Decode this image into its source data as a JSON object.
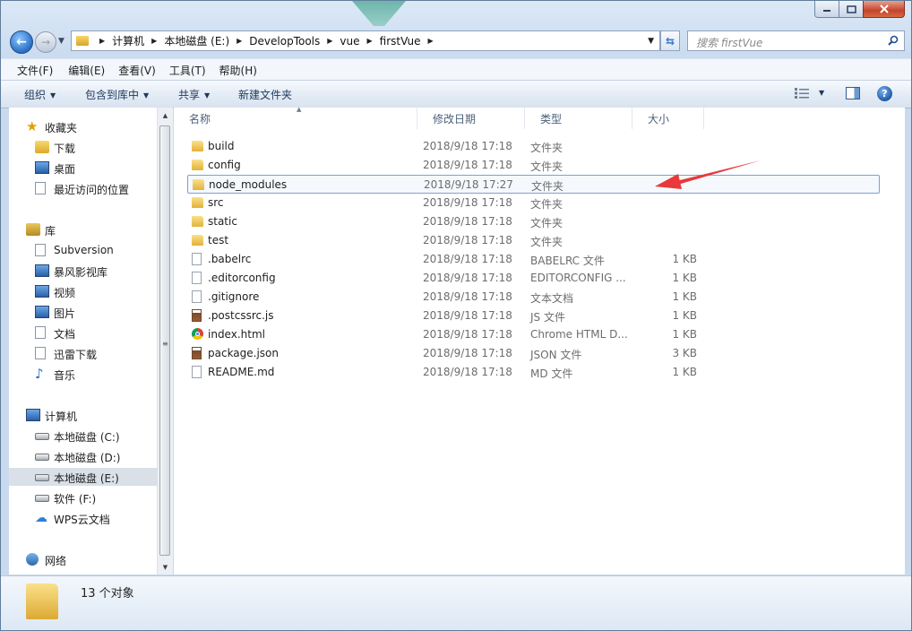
{
  "window": {
    "controls": {
      "minimize_icon": "minimize-icon",
      "maximize_icon": "maximize-icon",
      "close_icon": "close-icon"
    }
  },
  "address": {
    "crumbs": [
      "计算机",
      "本地磁盘 (E:)",
      "DevelopTools",
      "vue",
      "firstVue"
    ]
  },
  "search": {
    "placeholder": "搜索 firstVue"
  },
  "menu": [
    "文件(F)",
    "编辑(E)",
    "查看(V)",
    "工具(T)",
    "帮助(H)"
  ],
  "toolbar": {
    "organize": "组织",
    "include_library": "包含到库中",
    "share": "共享",
    "new_folder": "新建文件夹"
  },
  "nav": {
    "favorites": {
      "label": "收藏夹",
      "items": [
        "下载",
        "桌面",
        "最近访问的位置"
      ]
    },
    "libraries": {
      "label": "库",
      "items": [
        "Subversion",
        "暴风影视库",
        "视频",
        "图片",
        "文档",
        "迅雷下载",
        "音乐"
      ]
    },
    "computer": {
      "label": "计算机",
      "items": [
        "本地磁盘 (C:)",
        "本地磁盘 (D:)",
        "本地磁盘 (E:)",
        "软件 (F:)",
        "WPS云文档"
      ],
      "selected_index": 2
    },
    "network": {
      "label": "网络"
    }
  },
  "columns": {
    "name": "名称",
    "date": "修改日期",
    "type": "类型",
    "size": "大小"
  },
  "files": [
    {
      "name": "build",
      "date": "2018/9/18 17:18",
      "type": "文件夹",
      "size": "",
      "icon": "folder-icon"
    },
    {
      "name": "config",
      "date": "2018/9/18 17:18",
      "type": "文件夹",
      "size": "",
      "icon": "folder-icon"
    },
    {
      "name": "node_modules",
      "date": "2018/9/18 17:27",
      "type": "文件夹",
      "size": "",
      "icon": "folder-icon"
    },
    {
      "name": "src",
      "date": "2018/9/18 17:18",
      "type": "文件夹",
      "size": "",
      "icon": "folder-icon"
    },
    {
      "name": "static",
      "date": "2018/9/18 17:18",
      "type": "文件夹",
      "size": "",
      "icon": "folder-icon"
    },
    {
      "name": "test",
      "date": "2018/9/18 17:18",
      "type": "文件夹",
      "size": "",
      "icon": "folder-icon"
    },
    {
      "name": ".babelrc",
      "date": "2018/9/18 17:18",
      "type": "BABELRC 文件",
      "size": "1 KB",
      "icon": "file-icon"
    },
    {
      "name": ".editorconfig",
      "date": "2018/9/18 17:18",
      "type": "EDITORCONFIG ...",
      "size": "1 KB",
      "icon": "file-icon"
    },
    {
      "name": ".gitignore",
      "date": "2018/9/18 17:18",
      "type": "文本文档",
      "size": "1 KB",
      "icon": "file-icon"
    },
    {
      "name": ".postcssrc.js",
      "date": "2018/9/18 17:18",
      "type": "JS 文件",
      "size": "1 KB",
      "icon": "js-file-icon"
    },
    {
      "name": "index.html",
      "date": "2018/9/18 17:18",
      "type": "Chrome HTML D...",
      "size": "1 KB",
      "icon": "chrome-icon"
    },
    {
      "name": "package.json",
      "date": "2018/9/18 17:18",
      "type": "JSON 文件",
      "size": "3 KB",
      "icon": "js-file-icon"
    },
    {
      "name": "README.md",
      "date": "2018/9/18 17:18",
      "type": "MD 文件",
      "size": "1 KB",
      "icon": "file-icon"
    }
  ],
  "highlighted_file_index": 2,
  "annotation": {
    "color": "#e8393b",
    "icon": "red-arrow"
  },
  "status": {
    "count": "13 个对象"
  }
}
